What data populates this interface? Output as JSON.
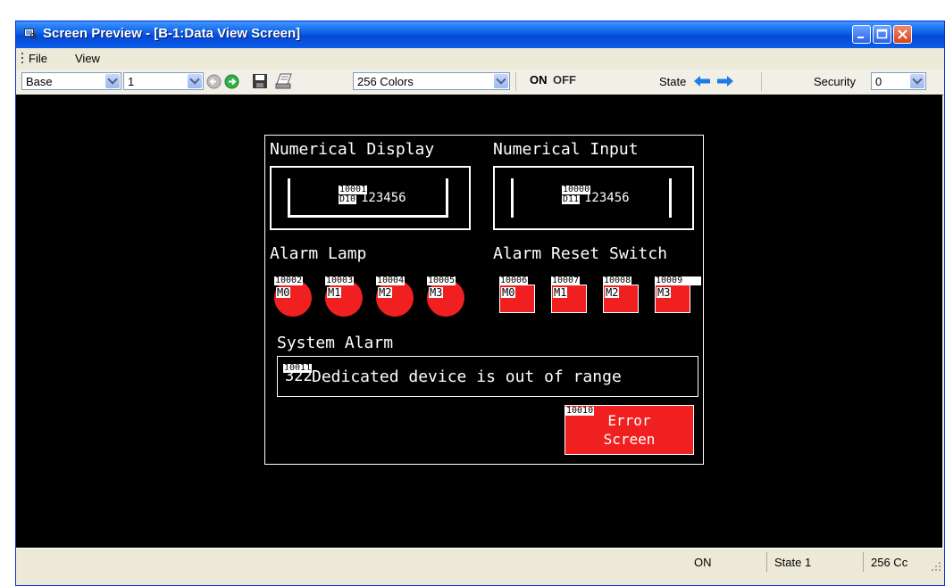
{
  "window": {
    "title": "Screen Preview - [B-1:Data View Screen]",
    "icon": "preview-window-icon"
  },
  "menu": {
    "items": [
      "File",
      "View"
    ]
  },
  "toolbar": {
    "screen_type": "Base",
    "screen_number": "1",
    "colors": "256 Colors",
    "on_label": "ON",
    "off_label": "OFF",
    "state_label": "State",
    "security_label": "Security",
    "security_value": "0"
  },
  "screen": {
    "numerical_display": {
      "label": "Numerical Display",
      "value": "123456",
      "tag_id": "10001",
      "device": "D10"
    },
    "numerical_input": {
      "label": "Numerical Input",
      "value": "123456",
      "tag_id": "10000",
      "device": "D11"
    },
    "alarm_lamp": {
      "label": "Alarm Lamp",
      "lamps": [
        {
          "tag": "10002",
          "device": "M0"
        },
        {
          "tag": "10003",
          "device": "M1"
        },
        {
          "tag": "10004",
          "device": "M2"
        },
        {
          "tag": "10005",
          "device": "M3"
        }
      ]
    },
    "alarm_reset_switch": {
      "label": "Alarm Reset Switch",
      "switches": [
        {
          "tag": "10006",
          "device": "M0"
        },
        {
          "tag": "10007",
          "device": "M1"
        },
        {
          "tag": "10008",
          "device": "M2"
        },
        {
          "tag": "10009",
          "device": "M3"
        }
      ]
    },
    "system_alarm": {
      "label": "System Alarm",
      "tag_id": "10011",
      "code": "322",
      "message": "Dedicated device is out of range"
    },
    "error_screen_button": {
      "tag_id": "10010",
      "line1": "Error",
      "line2": "Screen"
    }
  },
  "status": {
    "onoff": "ON",
    "state": "State 1",
    "colors": "256 Cc"
  },
  "colors": {
    "titlebar": "#0a5fe6",
    "canvas_bg": "#000000",
    "alarm_red": "#f02020"
  }
}
